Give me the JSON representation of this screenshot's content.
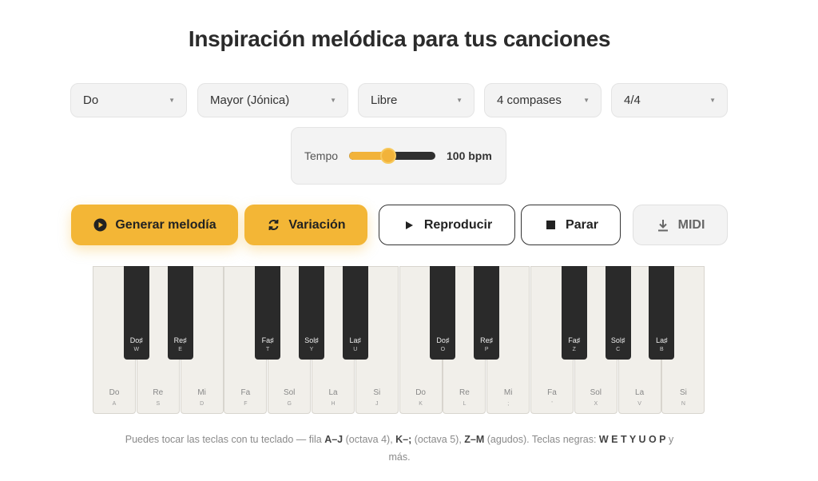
{
  "title": "Inspiración melódica para tus canciones",
  "selects": {
    "key": "Do",
    "scale": "Mayor (Jónica)",
    "mode": "Libre",
    "bars": "4 compases",
    "time": "4/4"
  },
  "tempo": {
    "label": "Tempo",
    "value": "100 bpm",
    "level": 0.45
  },
  "buttons": {
    "generate": "Generar melodía",
    "variation": "Variación",
    "play": "Reproducir",
    "stop": "Parar",
    "midi": "MIDI"
  },
  "piano": {
    "white_keys": [
      {
        "name": "Do",
        "key": "A"
      },
      {
        "name": "Re",
        "key": "S"
      },
      {
        "name": "Mi",
        "key": "D"
      },
      {
        "name": "Fa",
        "key": "F"
      },
      {
        "name": "Sol",
        "key": "G"
      },
      {
        "name": "La",
        "key": "H"
      },
      {
        "name": "Si",
        "key": "J"
      },
      {
        "name": "Do",
        "key": "K"
      },
      {
        "name": "Re",
        "key": "L"
      },
      {
        "name": "Mi",
        "key": ";"
      },
      {
        "name": "Fa",
        "key": "'"
      },
      {
        "name": "Sol",
        "key": "X"
      },
      {
        "name": "La",
        "key": "V"
      },
      {
        "name": "Si",
        "key": "N"
      }
    ],
    "black_keys": [
      {
        "name": "Do♯",
        "key": "W"
      },
      {
        "name": "Re♯",
        "key": "E"
      },
      {
        "name": "Fa♯",
        "key": "T"
      },
      {
        "name": "Sol♯",
        "key": "Y"
      },
      {
        "name": "La♯",
        "key": "U"
      },
      {
        "name": "Do♯",
        "key": "O"
      },
      {
        "name": "Re♯",
        "key": "P"
      },
      {
        "name": "Fa♯",
        "key": "Z"
      },
      {
        "name": "Sol♯",
        "key": "C"
      },
      {
        "name": "La♯",
        "key": "B"
      }
    ]
  },
  "help": {
    "t1": "Puedes tocar las teclas con tu teclado — fila ",
    "b1": "A–J",
    "t2": " (octava 4), ",
    "b2": "K–;",
    "t3": " (octava 5), ",
    "b3": "Z–M",
    "t4": " (agudos). Teclas negras: ",
    "b4": "W E T Y U O P",
    "t5": " y más."
  }
}
